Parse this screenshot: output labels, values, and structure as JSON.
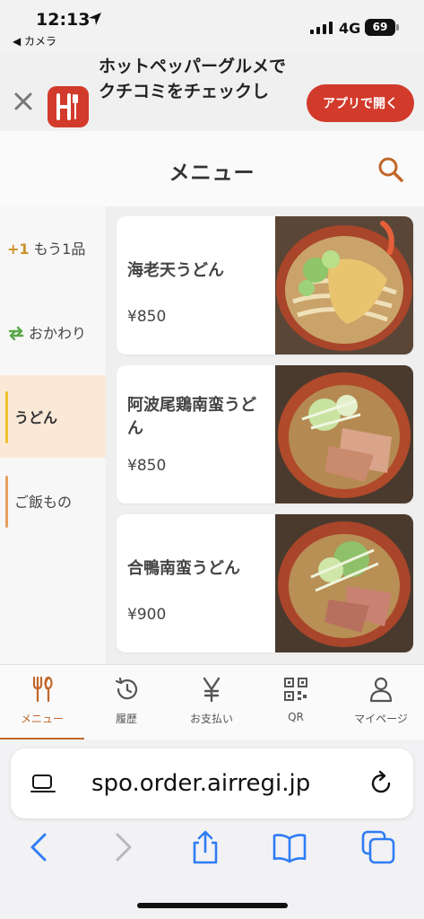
{
  "status_bar": {
    "time": "12:13",
    "back_app": "◀ カメラ",
    "network": "4G",
    "battery": "69"
  },
  "app_banner": {
    "text": "ホットペッパーグルメで\nクチコミをチェックし",
    "open_button": "アプリで開く",
    "accent": "#d23a2b"
  },
  "header": {
    "title": "メニュー",
    "search_icon": "search-icon"
  },
  "categories": [
    {
      "prefix": "+1",
      "label": "もう1品",
      "active": false
    },
    {
      "prefix": "",
      "label": "おかわり",
      "active": false,
      "icon": "refresh-icon"
    },
    {
      "prefix": "",
      "label": "うどん",
      "active": true
    },
    {
      "prefix": "",
      "label": "ご飯もの",
      "active": false
    }
  ],
  "menu_items": [
    {
      "name": "海老天うどん",
      "price": "¥850"
    },
    {
      "name": "阿波尾鶏南蛮うどん",
      "price": "¥850"
    },
    {
      "name": "合鴨南蛮うどん",
      "price": "¥900"
    }
  ],
  "tabs": [
    {
      "label": "メニュー",
      "icon": "utensils-icon",
      "active": true
    },
    {
      "label": "履歴",
      "icon": "history-icon",
      "active": false
    },
    {
      "label": "お支払い",
      "icon": "yen-icon",
      "active": false
    },
    {
      "label": "QR",
      "icon": "qr-icon",
      "active": false
    },
    {
      "label": "マイページ",
      "icon": "person-icon",
      "active": false
    }
  ],
  "browser": {
    "url": "spo.order.airregi.jp"
  },
  "colors": {
    "brand": "#c0662a",
    "active_category_bg": "#fbe9d7",
    "ios_blue": "#2f7cf6"
  }
}
